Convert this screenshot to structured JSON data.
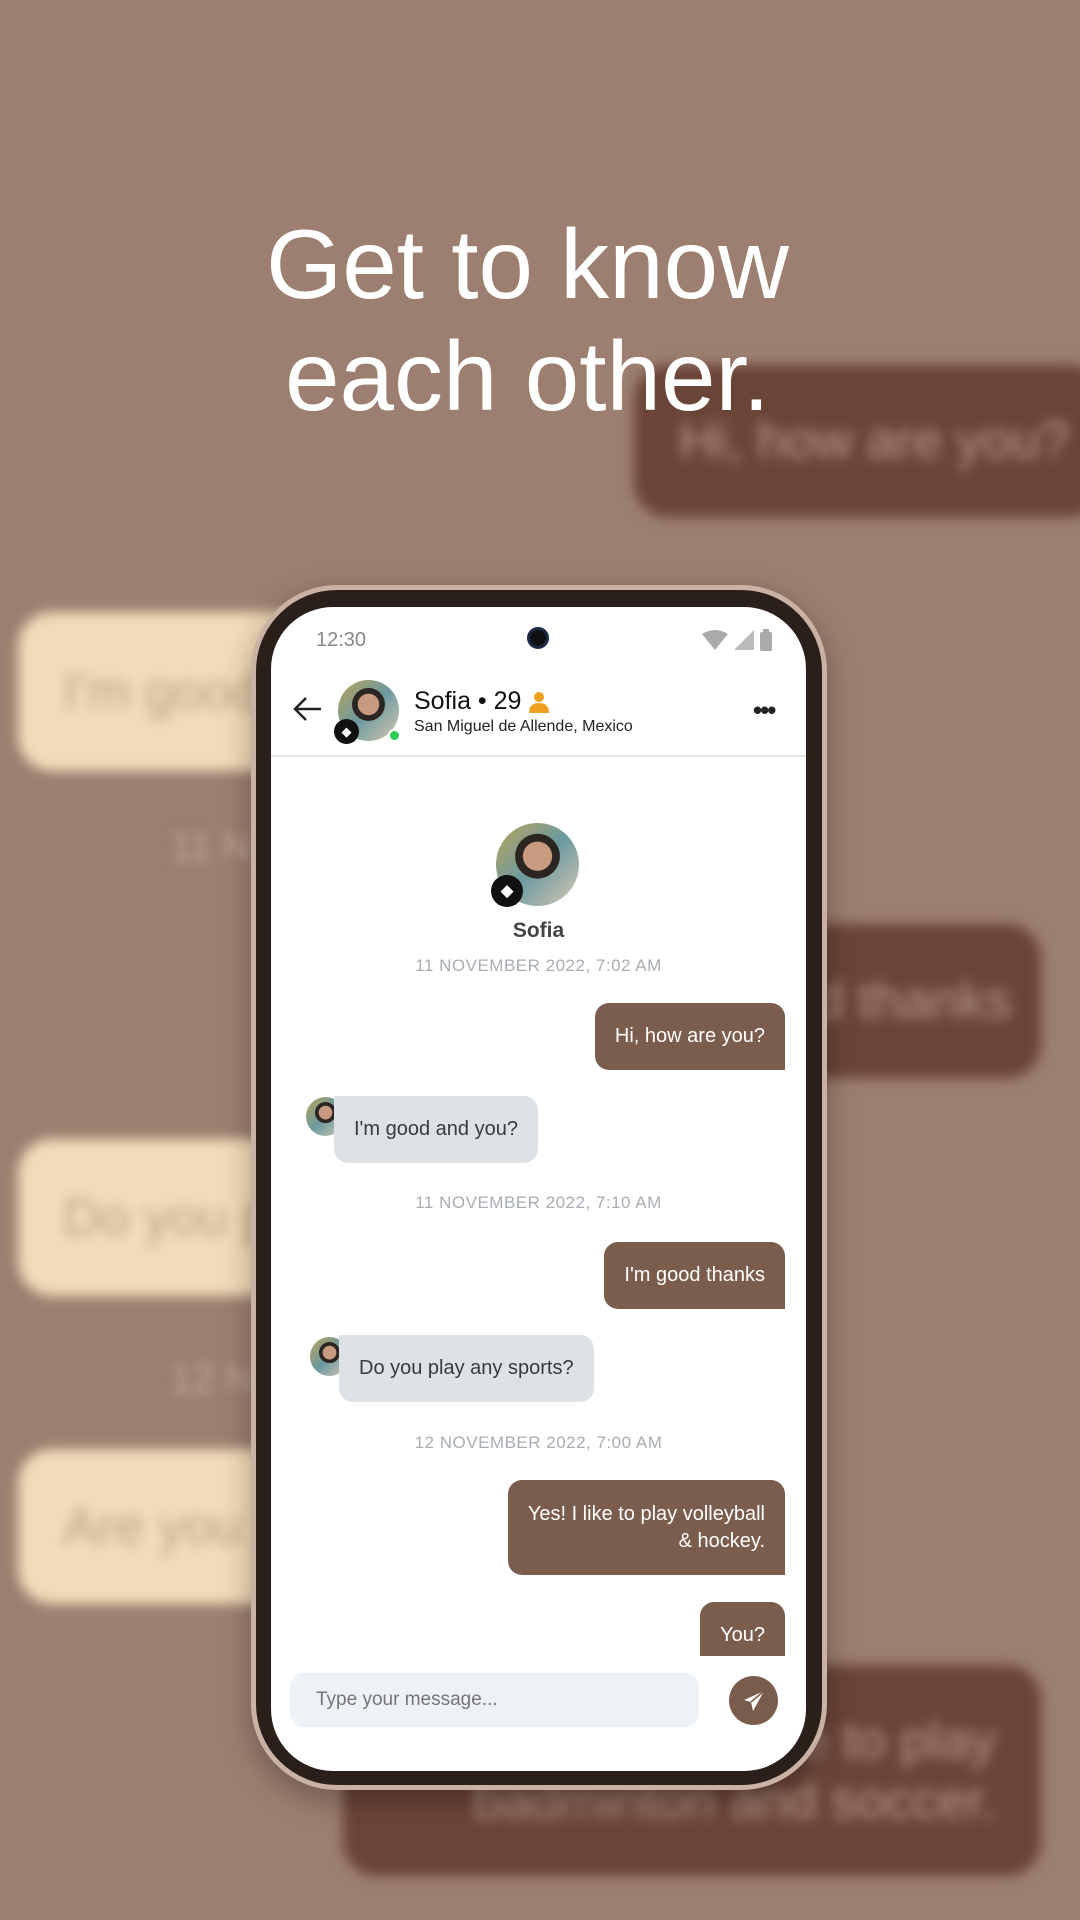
{
  "headline": {
    "line1": "Get to know",
    "line2": "each other."
  },
  "background": {
    "bubbles": [
      "Hi, how are you?",
      "I'm good",
      "d thanks",
      "Do you p",
      "Are you",
      "e to play",
      "badminton and soccer."
    ],
    "dates": [
      "11 N",
      "12 N"
    ]
  },
  "status_bar": {
    "time": "12:30"
  },
  "header": {
    "name_age": "Sofia • 29",
    "location": "San Miguel de Allende, Mexico",
    "online": true
  },
  "profile": {
    "name": "Sofia"
  },
  "messages": [
    {
      "type": "date",
      "text": "11 NOVEMBER 2022, 7:02 AM"
    },
    {
      "type": "out",
      "text": "Hi, how are you?"
    },
    {
      "type": "in",
      "text": "I'm good and you?"
    },
    {
      "type": "date",
      "text": "11 NOVEMBER 2022, 7:10 AM"
    },
    {
      "type": "out",
      "text": "I'm good thanks"
    },
    {
      "type": "in",
      "text": "Do you play any sports?"
    },
    {
      "type": "date",
      "text": "12 NOVEMBER 2022, 7:00 AM"
    },
    {
      "type": "out",
      "line1": "Yes! I like to play volleyball",
      "line2": "& hockey."
    },
    {
      "type": "out",
      "text": "You?"
    }
  ],
  "composer": {
    "placeholder": "Type your message..."
  },
  "colors": {
    "background": "#9c7f70",
    "outgoing": "#7b5d4d",
    "incoming": "#dde2e6",
    "online": "#2ecc5a",
    "verified": "#f0a020"
  }
}
